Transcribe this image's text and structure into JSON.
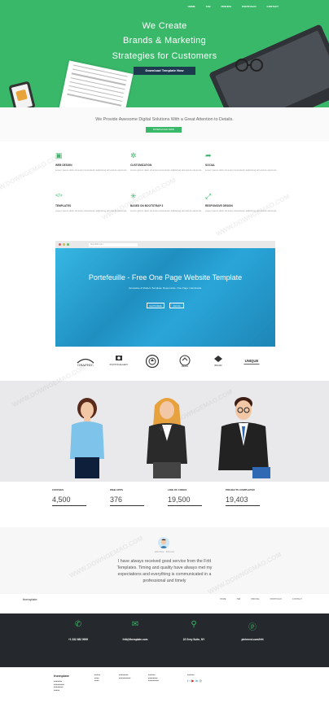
{
  "nav": [
    "HOME",
    "TAB",
    "PRICING",
    "PORTFOLIO",
    "CONTACT"
  ],
  "hero": {
    "line1": "We Create",
    "line2": "Brands & Marketing",
    "line3": "Strategies for Customers",
    "button": "Download Template Now"
  },
  "intro": {
    "text": "We Provide Awesome Digital Solutions With a Great Attention to Details.",
    "button": "DOWNLOAD NOW"
  },
  "features": [
    {
      "icon": "web-design-icon",
      "glyph": "▣",
      "title": "WEB DESIGN",
      "text": "Lorem ipsum dolor sit amet consectetur adipiscing elit sed do eiusmod."
    },
    {
      "icon": "customization-icon",
      "glyph": "✲",
      "title": "CUSTOMIZATION",
      "text": "Lorem ipsum dolor sit amet consectetur adipiscing elit sed do eiusmod."
    },
    {
      "icon": "social-icon",
      "glyph": "➦",
      "title": "SOCIAL",
      "text": "Lorem ipsum dolor sit amet consectetur adipiscing elit sed do eiusmod."
    },
    {
      "icon": "templates-icon",
      "glyph": "</>",
      "title": "TEMPLATES",
      "text": "Lorem ipsum dolor sit amet consectetur adipiscing elit sed do eiusmod."
    },
    {
      "icon": "bootstrap-icon",
      "glyph": "✳",
      "title": "BASED ON BOOTSTRAP 3",
      "text": "Lorem ipsum dolor sit amet consectetur adipiscing elit sed do eiusmod."
    },
    {
      "icon": "responsive-icon",
      "glyph": "⤢",
      "title": "RESPONSIVE DESIGN",
      "text": "Lorem ipsum dolor sit amet consectetur adipiscing elit sed do eiusmod."
    }
  ],
  "browser": {
    "url": "http://fritt.com",
    "title": "Portefeuille - Free One Page Website Template",
    "subtitle": "Innovative & Modern Template. Responsive. One Page. Handmade.",
    "btn1": "Get Portfolio",
    "btn2": "Join Us"
  },
  "logos": [
    "GRAPHIC",
    "PHOTOGALLERY",
    "",
    "MEDIA",
    "BRAND",
    "UNIQUE"
  ],
  "stats": [
    {
      "label": "COFFEES",
      "value": "4,500"
    },
    {
      "label": "WEB APPS",
      "value": "376"
    },
    {
      "label": "LINE OF CODES",
      "value": "19,500"
    },
    {
      "label": "PROJECTS COMPLETED",
      "value": "19,403"
    }
  ],
  "testimonial": {
    "name": "John Doe · Fritt.com",
    "text": "I have always received good service from the Fritt Templates. Timing and quality have always met my expectations and everything is communicated in a professional and timely"
  },
  "subnav": {
    "brand": "themplate",
    "links": [
      "HOME",
      "TAB",
      "PRICING",
      "PORTFOLIO",
      "CONTACT"
    ]
  },
  "contact": [
    {
      "icon": "phone-icon",
      "glyph": "✆",
      "text": "+1 332 682 9999"
    },
    {
      "icon": "mail-icon",
      "glyph": "✉",
      "text": "fritt@themplate.com"
    },
    {
      "icon": "location-icon",
      "glyph": "⚲",
      "text": "22 Grey Suite, NY"
    },
    {
      "icon": "pinterest-icon",
      "glyph": "ⓟ",
      "text": "pinterest.com/fritt"
    }
  ],
  "footer": {
    "brand": "themplate",
    "watermark": "WWW.DOWNGEMAO.COM"
  }
}
